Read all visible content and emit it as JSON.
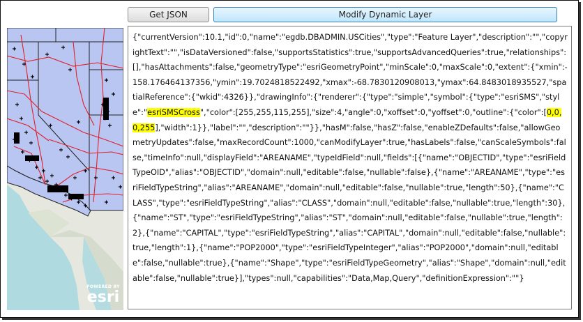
{
  "toolbar": {
    "get_json_label": "Get JSON",
    "modify_layer_label": "Modify Dynamic Layer"
  },
  "map": {
    "attribution_powered": "POWERED BY",
    "attribution_brand": "esri",
    "colors": {
      "land_fill": "#b9c6f2",
      "boundary": "#222222",
      "roads": "#e0202e",
      "points": "#000000",
      "basemap": "#e9e9e4",
      "water": "#a8d8e0"
    }
  },
  "json_output": {
    "part1": "{\"currentVersion\":10.1,\"id\":0,\"name\":\"egdb.DBADMIN.USCities\",\"type\":\"Feature Layer\",\"description\":\"\",\"copyrightText\":\"\",\"isDataVersioned\":false,\"supportsStatistics\":true,\"supportsAdvancedQueries\":true,\"relationships\":[],\"hasAttachments\":false,\"geometryType\":\"esriGeometryPoint\",\"minScale\":0,\"maxScale\":0,\"extent\":{\"xmin\":-158.176464137356,\"ymin\":19.7024818522492,\"xmax\":-68.7830120908013,\"ymax\":64.8483018935527,\"spatialReference\":{\"wkid\":4326}},\"drawingInfo\":{\"renderer\":{\"type\":\"simple\",\"symbol\":{\"type\":\"esriSMS\",\"style\":\"",
    "highlight1": "esriSMSCross",
    "part2": "\",\"color\":[255,255,115,255],\"size\":4,\"angle\":0,\"xoffset\":0,\"yoffset\":0,\"outline\":{\"color\":[",
    "highlight2": "0,0,0,255",
    "part3": "],\"width\":1}},\"label\":\"\",\"description\":\"\"}},\"hasM\":false,\"hasZ\":false,\"enableZDefaults\":false,\"allowGeometryUpdates\":false,\"maxRecordCount\":1000,\"canModifyLayer\":true,\"hasLabels\":false,\"canScaleSymbols\":false,\"timeInfo\":null,\"displayField\":\"AREANAME\",\"typeIdField\":null,\"fields\":[{\"name\":\"OBJECTID\",\"type\":\"esriFieldTypeOID\",\"alias\":\"OBJECTID\",\"domain\":null,\"editable\":false,\"nullable\":false},{\"name\":\"AREANAME\",\"type\":\"esriFieldTypeString\",\"alias\":\"AREANAME\",\"domain\":null,\"editable\":false,\"nullable\":true,\"length\":50},{\"name\":\"CLASS\",\"type\":\"esriFieldTypeString\",\"alias\":\"CLASS\",\"domain\":null,\"editable\":false,\"nullable\":true,\"length\":30},{\"name\":\"ST\",\"type\":\"esriFieldTypeString\",\"alias\":\"ST\",\"domain\":null,\"editable\":false,\"nullable\":true,\"length\":2},{\"name\":\"CAPITAL\",\"type\":\"esriFieldTypeString\",\"alias\":\"CAPITAL\",\"domain\":null,\"editable\":false,\"nullable\":true,\"length\":1},{\"name\":\"POP2000\",\"type\":\"esriFieldTypeInteger\",\"alias\":\"POP2000\",\"domain\":null,\"editable\":false,\"nullable\":true},{\"name\":\"Shape\",\"type\":\"esriFieldTypeGeometry\",\"alias\":\"Shape\",\"domain\":null,\"editable\":false,\"nullable\":true}],\"types\":null,\"capabilities\":\"Data,Map,Query\",\"definitionExpression\":\"\"}"
  }
}
